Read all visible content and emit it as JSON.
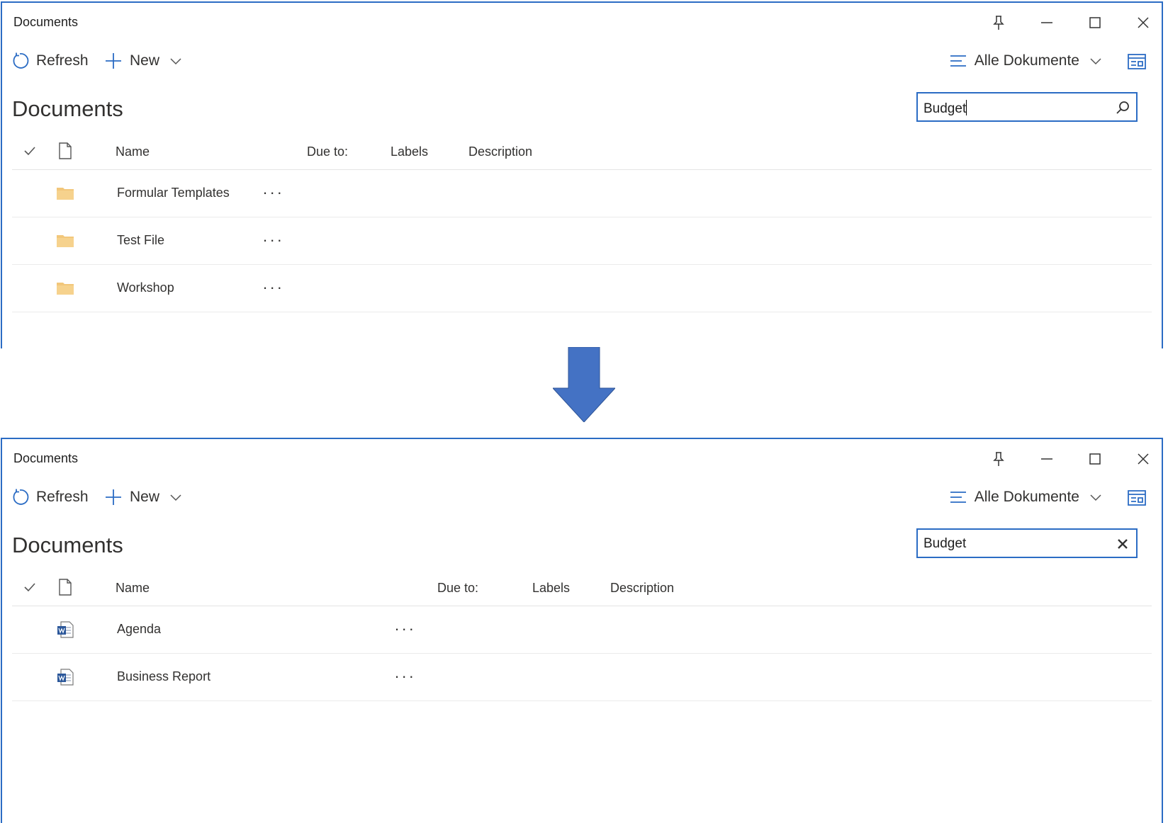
{
  "before": {
    "window_title": "Documents",
    "toolbar": {
      "refresh_label": "Refresh",
      "new_label": "New",
      "view_label": "Alle Dokumente"
    },
    "page_title": "Documents",
    "search": {
      "value": "Budget",
      "button_icon": "search-icon"
    },
    "columns": {
      "name": "Name",
      "due": "Due to:",
      "labels": "Labels",
      "description": "Description"
    },
    "rows": [
      {
        "name": "Formular Templates",
        "icon": "folder-icon"
      },
      {
        "name": "Test File",
        "icon": "folder-icon"
      },
      {
        "name": "Workshop",
        "icon": "folder-icon"
      }
    ],
    "more_label": "..."
  },
  "after": {
    "window_title": "Documents",
    "toolbar": {
      "refresh_label": "Refresh",
      "new_label": "New",
      "view_label": "Alle Dokumente"
    },
    "page_title": "Documents",
    "search": {
      "value": "Budget",
      "button_icon": "clear-icon"
    },
    "columns": {
      "name": "Name",
      "due": "Due to:",
      "labels": "Labels",
      "description": "Description"
    },
    "rows": [
      {
        "name": "Agenda",
        "icon": "word-document-icon"
      },
      {
        "name": "Business Report",
        "icon": "word-document-icon"
      }
    ],
    "more_label": "..."
  },
  "colors": {
    "accent": "#2b6cc4",
    "arrow": "#4472c4",
    "folder": "#f2c77b",
    "word": "#2b579a"
  }
}
